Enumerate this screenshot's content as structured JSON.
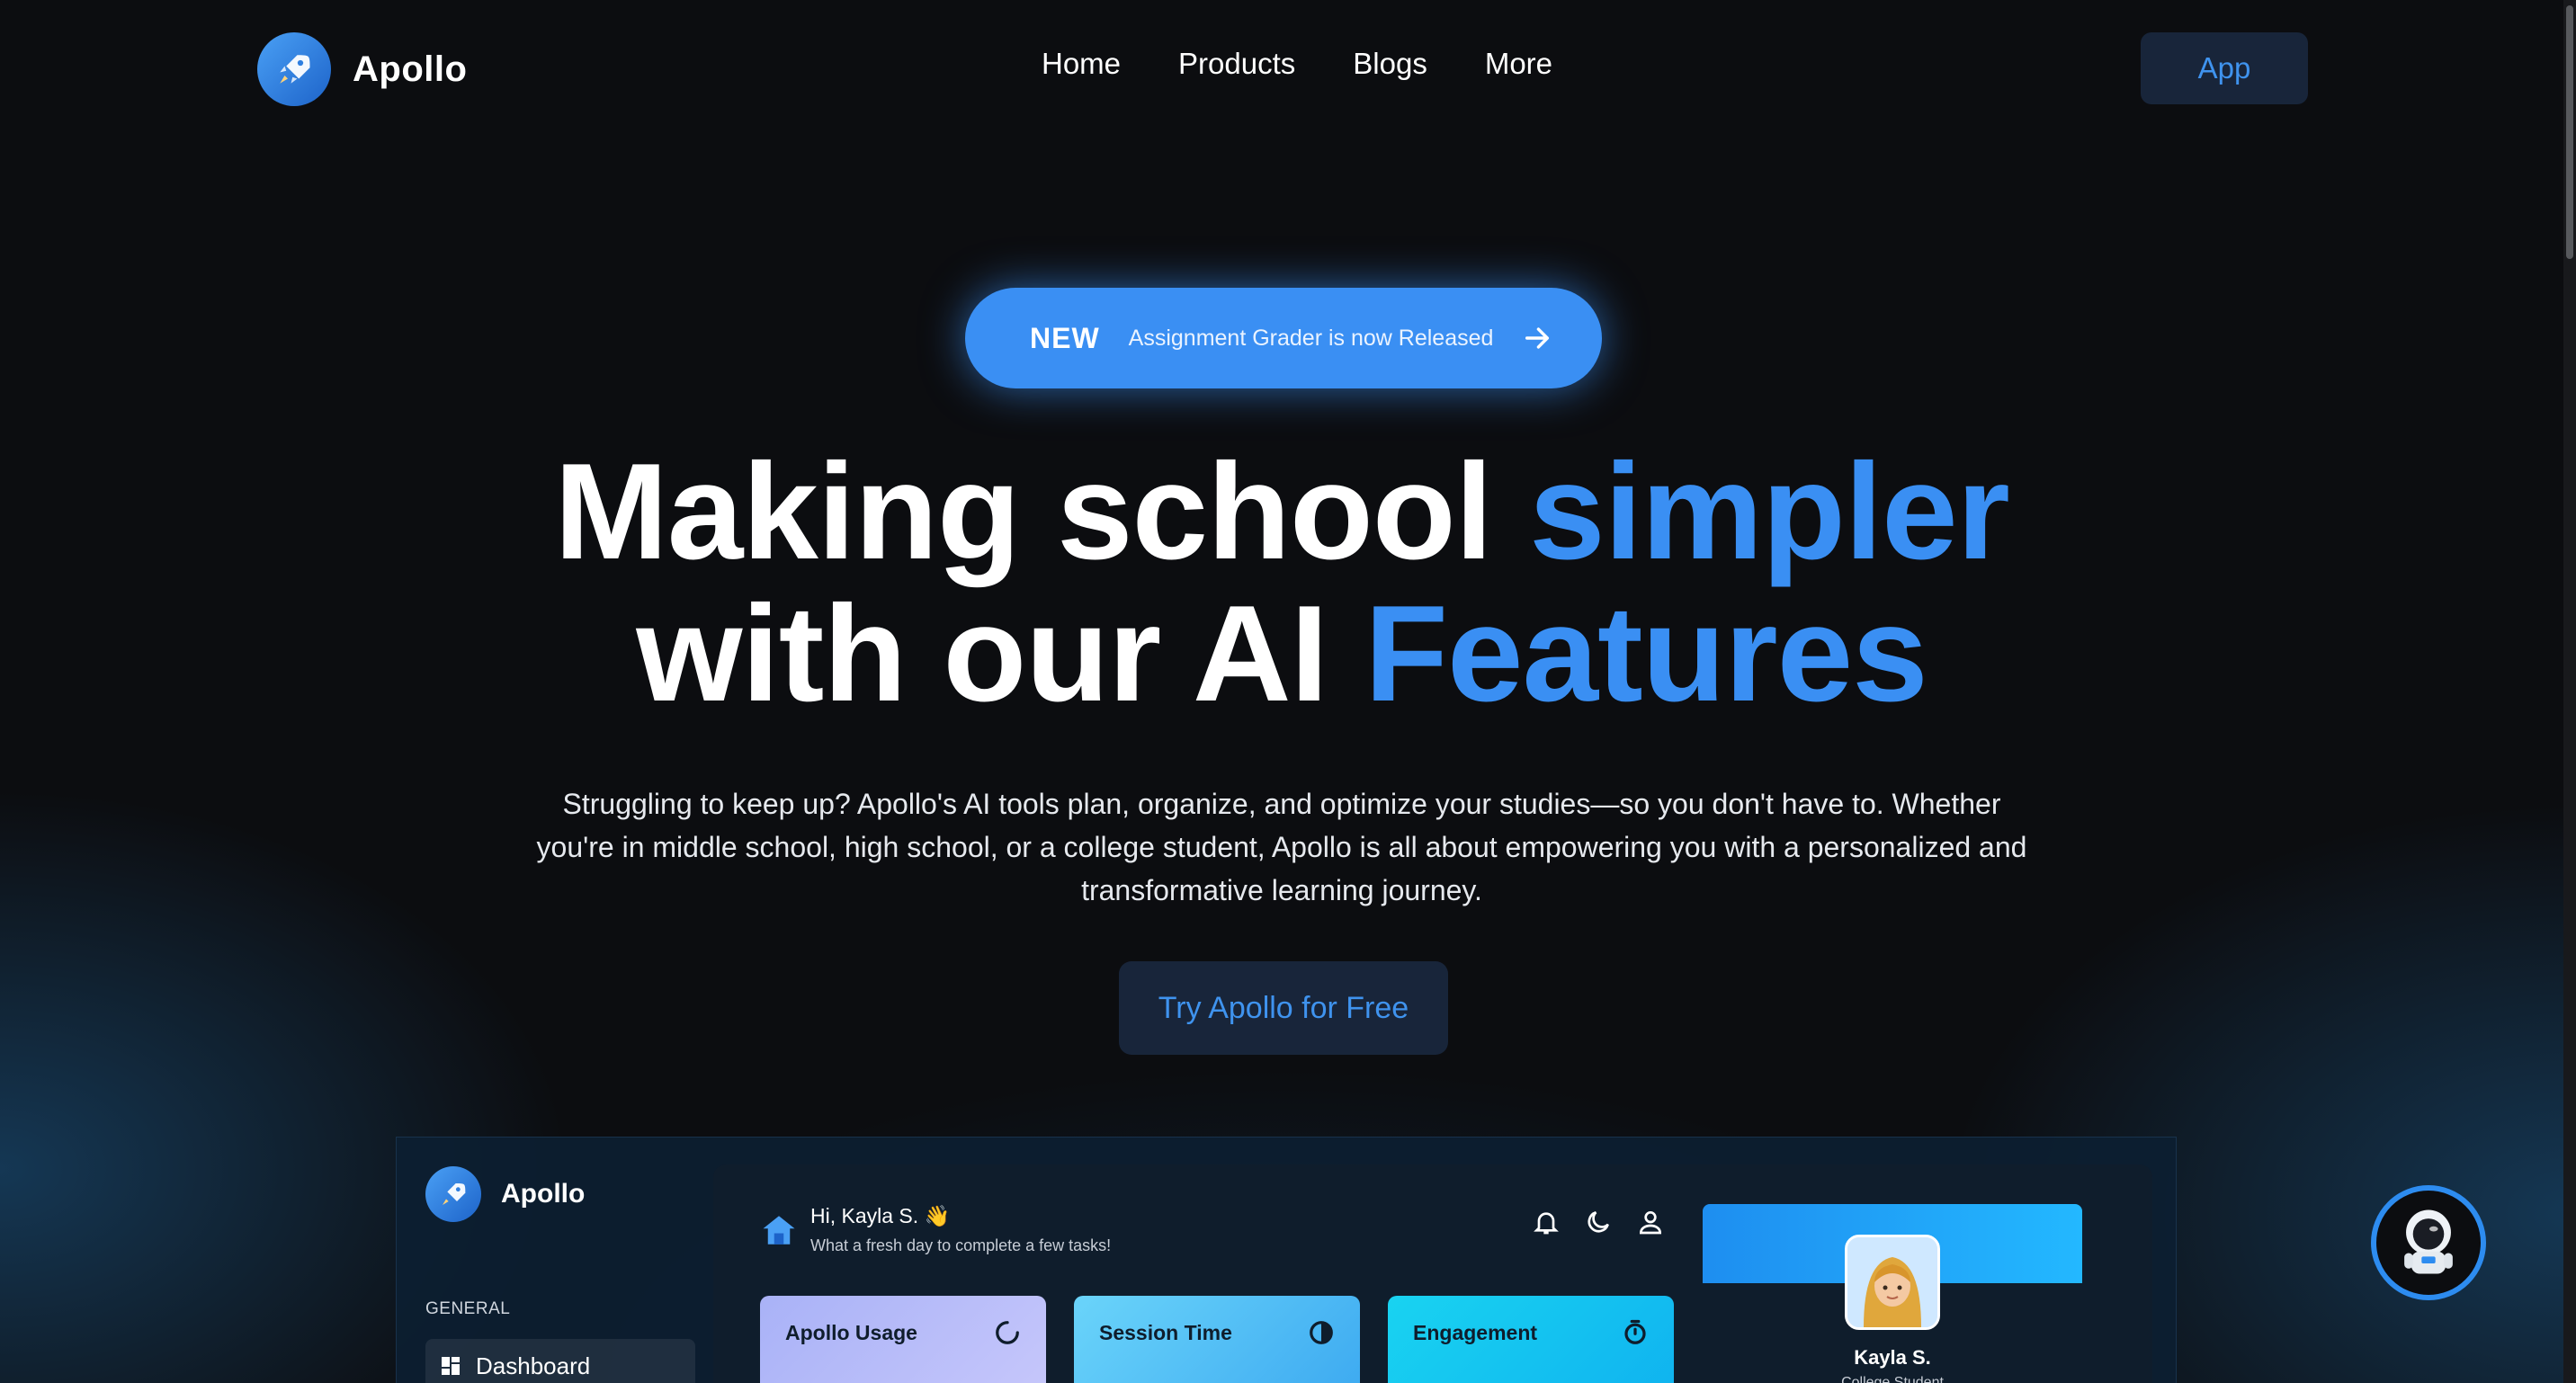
{
  "brand": {
    "name": "Apollo"
  },
  "nav": {
    "links": [
      "Home",
      "Products",
      "Blogs",
      "More"
    ],
    "app_button": "App"
  },
  "announcement": {
    "badge": "NEW",
    "text": "Assignment Grader is now Released"
  },
  "hero": {
    "line1_a": "Making school ",
    "line1_accent": "simpler",
    "line2_a": "with our AI ",
    "line2_accent": "Features",
    "subtext": "Struggling to keep up? Apollo's AI tools plan, organize, and optimize your studies—so you don't have to. Whether you're in middle school, high school, or a college student, Apollo is all about empowering you with a personalized and transformative learning journey.",
    "cta": "Try Apollo for Free"
  },
  "preview": {
    "brand": "Apollo",
    "section_label": "GENERAL",
    "nav_item": "Dashboard",
    "greeting": "Hi, Kayla S. 👋",
    "greeting_sub": "What a fresh day to complete a few tasks!",
    "cards": [
      "Apollo Usage",
      "Session Time",
      "Engagement"
    ],
    "profile": {
      "name": "Kayla S.",
      "role": "College Student"
    }
  },
  "colors": {
    "accent": "#3a8ff3",
    "background": "#0c0d10",
    "button_bg": "#18253a"
  },
  "icons": {
    "logo": "rocket-icon",
    "announce": "arrow-right-icon",
    "bot": "astronaut-icon"
  }
}
